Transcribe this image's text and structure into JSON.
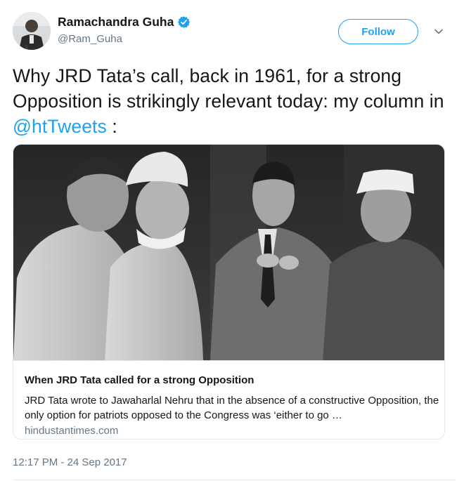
{
  "author": {
    "name": "Ramachandra Guha",
    "handle": "@Ram_Guha",
    "verified": true
  },
  "follow_label": "Follow",
  "icons": {
    "verified": "verified-badge-icon",
    "menu": "chevron-down-icon"
  },
  "tweet": {
    "text_before": "Why JRD Tata’s call, back in 1961, for a strong Opposition is strikingly relevant today: my column in ",
    "mention": "@htTweets",
    "text_after": " :"
  },
  "card": {
    "title": "When JRD Tata called for a strong Opposition",
    "description": "JRD Tata wrote to Jawaharlal Nehru that in the absence of a constructive Opposition, the only option for patriots opposed to the Congress was ‘either to go …",
    "domain": "hindustantimes.com"
  },
  "timestamp": "12:17 PM - 24 Sep 2017",
  "colors": {
    "accent": "#1da1f2",
    "secondary_text": "#657786",
    "text": "#14171a",
    "border": "#e1e8ed"
  }
}
